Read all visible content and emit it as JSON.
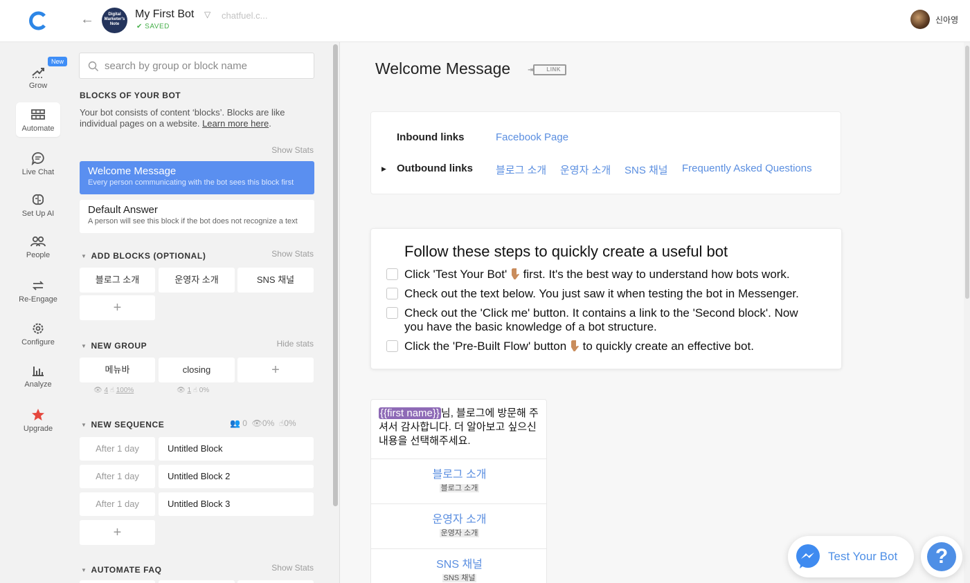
{
  "header": {
    "bot_avatar_text": "Digital Marketer's Note",
    "bot_name": "My First Bot",
    "saved_label": "SAVED",
    "bot_url": "chatfuel.c...",
    "user_name": "신아영"
  },
  "nav": {
    "new_badge": "New",
    "items": [
      {
        "label": "Grow",
        "icon": "grow-icon"
      },
      {
        "label": "Automate",
        "icon": "automate-icon"
      },
      {
        "label": "Live Chat",
        "icon": "chat-icon"
      },
      {
        "label": "Set Up AI",
        "icon": "brain-icon"
      },
      {
        "label": "People",
        "icon": "people-icon"
      },
      {
        "label": "Re-Engage",
        "icon": "reengage-icon"
      },
      {
        "label": "Configure",
        "icon": "gear-icon"
      },
      {
        "label": "Analyze",
        "icon": "chart-icon"
      },
      {
        "label": "Upgrade",
        "icon": "star-icon"
      }
    ]
  },
  "blocks": {
    "search_placeholder": "search by group or block name",
    "section_title": "BLOCKS OF YOUR BOT",
    "desc": "Your bot consists of content ‘blocks’. Blocks are like individual pages on a website.",
    "learn_more": "Learn more here",
    "show_stats": "Show Stats",
    "hide_stats": "Hide stats",
    "welcome": {
      "title": "Welcome Message",
      "desc": "Every person communicating with the bot sees this block first"
    },
    "default": {
      "title": "Default Answer",
      "desc": "A person will see this block if the bot does not recognize a text"
    },
    "add_blocks": {
      "title": "ADD BLOCKS (OPTIONAL)",
      "chips": [
        "블로그 소개",
        "운영자 소개",
        "SNS 채널"
      ]
    },
    "new_group": {
      "title": "NEW GROUP",
      "chips": [
        "메뉴바",
        "closing"
      ],
      "stats": [
        {
          "views": "4",
          "clicks": "100%"
        },
        {
          "views": "1",
          "clicks": "0%"
        }
      ]
    },
    "new_sequence": {
      "title": "NEW SEQUENCE",
      "stats": {
        "people": "0",
        "views": "0%",
        "clicks": "0%"
      },
      "rows": [
        {
          "delay": "After 1 day",
          "block": "Untitled Block"
        },
        {
          "delay": "After 1 day",
          "block": "Untitled Block 2"
        },
        {
          "delay": "After 1 day",
          "block": "Untitled Block 3"
        }
      ]
    },
    "automate_faq": {
      "title": "AUTOMATE FAQ"
    }
  },
  "main": {
    "block_title": "Welcome Message",
    "link_label": "LINK",
    "inbound_label": "Inbound links",
    "inbound_links": [
      "Facebook Page"
    ],
    "outbound_label": "Outbound links",
    "outbound_links": [
      "블로그 소개",
      "운영자 소개",
      "SNS 채널",
      "Frequently Asked Questions"
    ],
    "steps_title": "Follow these steps to quickly create a useful bot",
    "steps": [
      {
        "pre": "Click 'Test Your Bot' ",
        "post": " first. It's the best way to understand how bots work."
      },
      {
        "pre": "Check out the text below. You just saw it when testing the bot in Messenger.",
        "post": ""
      },
      {
        "pre": "Check out the 'Click me' button. It contains a link to the 'Second block'. Now you have the basic knowledge of a bot structure.",
        "post": ""
      },
      {
        "pre": "Click the 'Pre-Built Flow' button ",
        "post": " to quickly create an effective bot."
      }
    ],
    "message": {
      "variable": "{{first name}}",
      "text": "님, 블로그에 방문해 주셔서 감사합니다. 더 알아보고 싶으신 내용을 선택해주세요.",
      "buttons": [
        {
          "title": "블로그 소개",
          "target": "블로그 소개"
        },
        {
          "title": "운영자 소개",
          "target": "운영자 소개"
        },
        {
          "title": "SNS 채널",
          "target": "SNS 채널"
        }
      ]
    }
  },
  "floating": {
    "test_label": "Test Your Bot",
    "help_label": "?"
  }
}
